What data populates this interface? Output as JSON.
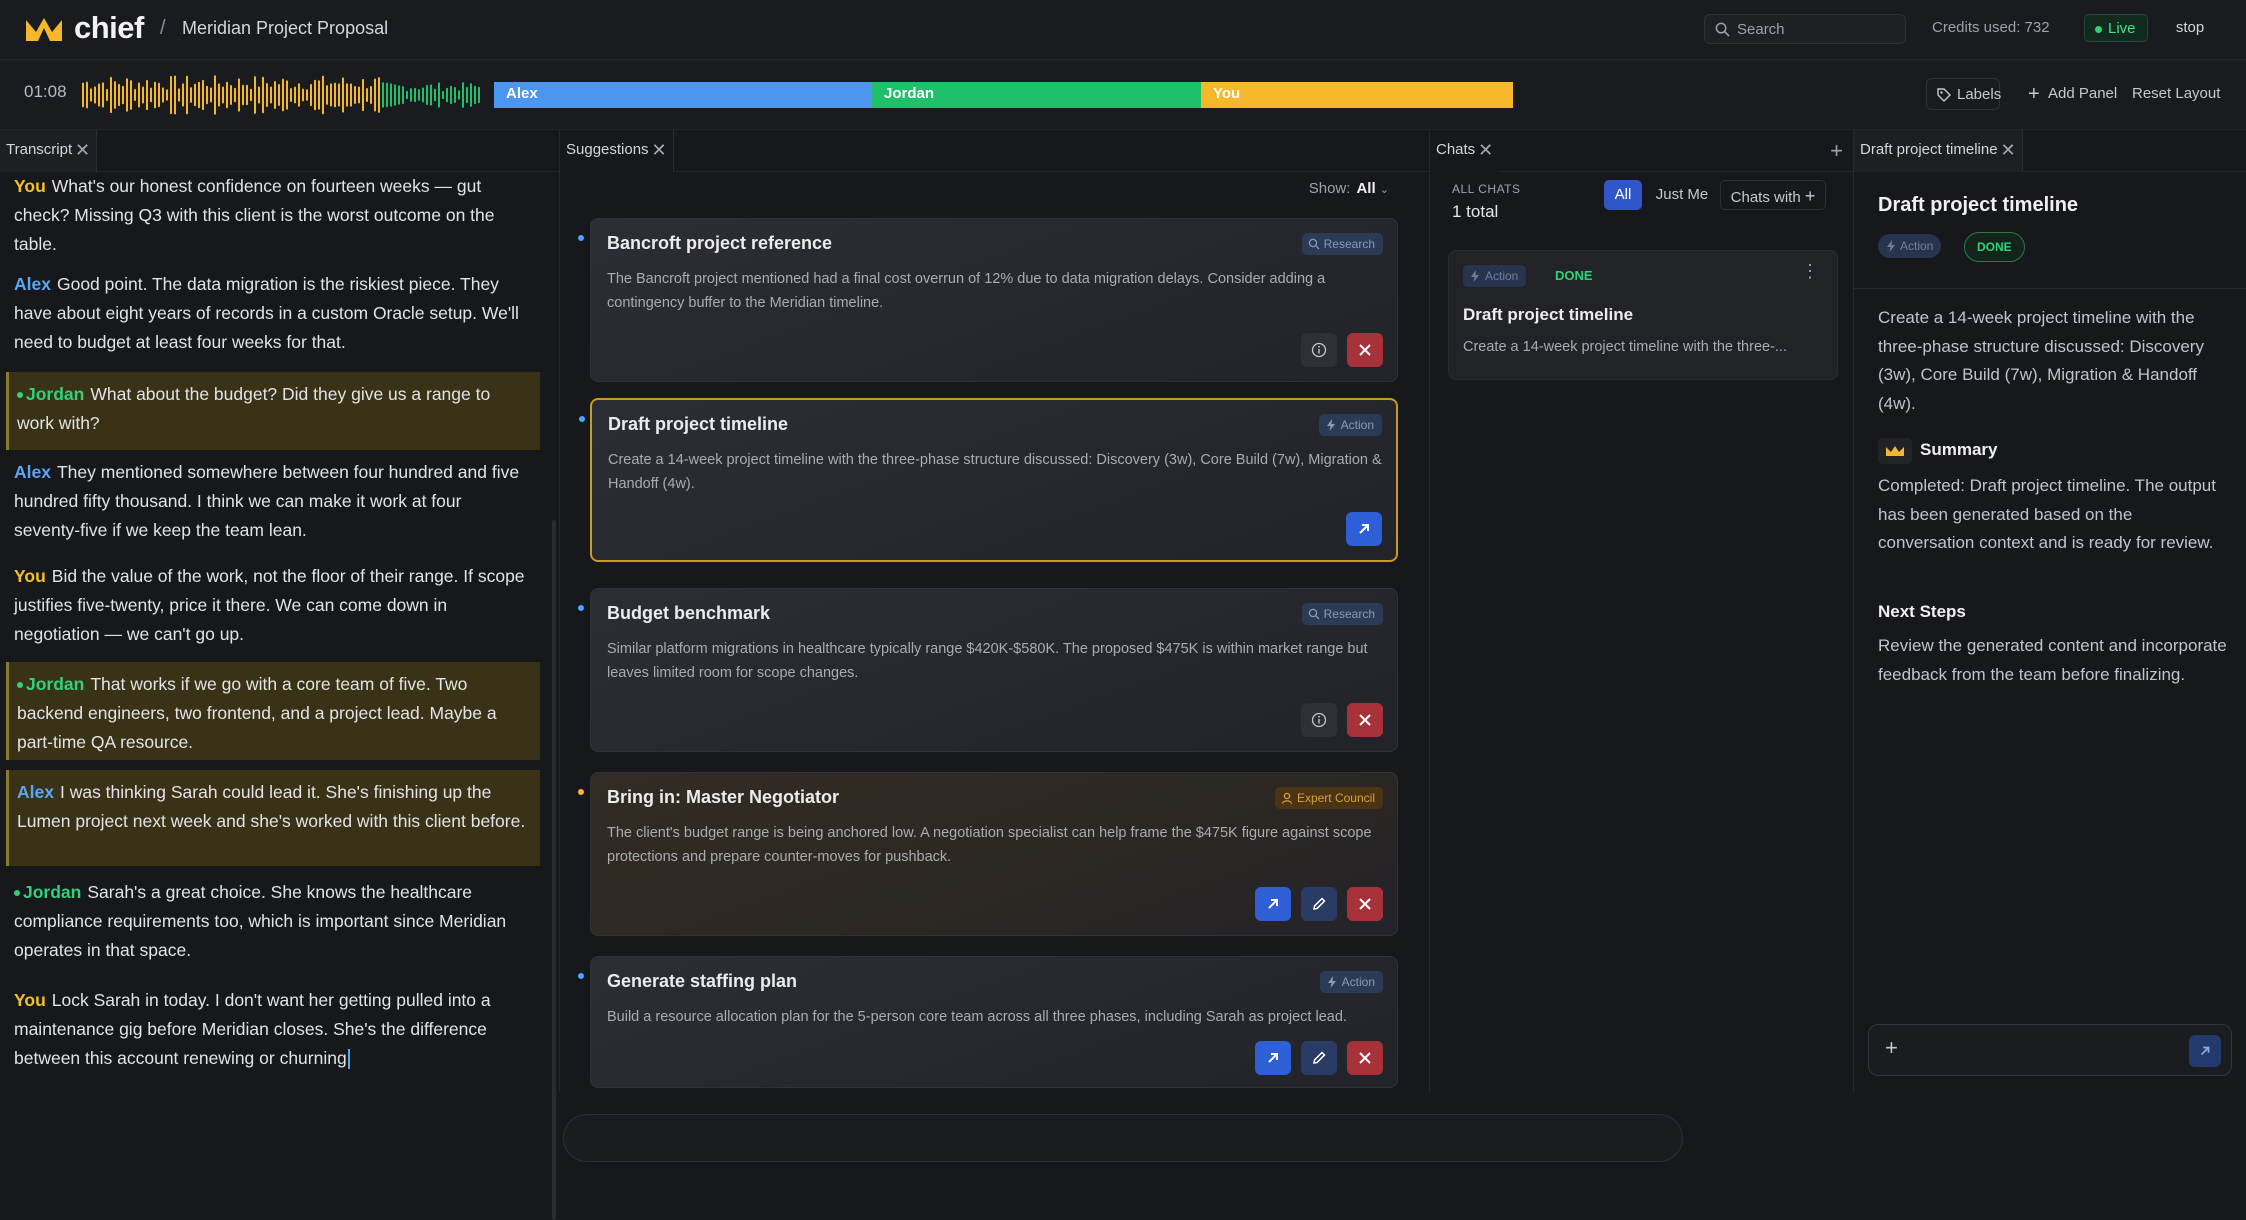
{
  "header": {
    "brand": "chief",
    "separator": "/",
    "project": "Meridian Project Proposal",
    "search_placeholder": "Search",
    "credits": "Credits used:  732",
    "live": "Live",
    "stop": "stop"
  },
  "audio": {
    "time": "01:08",
    "speakers": [
      {
        "name": "Alex",
        "color": "#4a96f0"
      },
      {
        "name": "Jordan",
        "color": "#1fc06a"
      },
      {
        "name": "You",
        "color": "#f5b82a"
      }
    ],
    "labels_btn": "Labels",
    "add_panel": "Add Panel",
    "reset_layout": "Reset Layout"
  },
  "transcript": {
    "tab": "Transcript",
    "messages": [
      {
        "speaker": "You",
        "text": "What's our honest confidence on fourteen weeks — gut check? Missing Q3 with this client is the worst outcome on the table."
      },
      {
        "speaker": "Alex",
        "text": "Good point. The data migration is the riskiest piece. They have about eight years of records in a custom Oracle setup. We'll need to budget at least four weeks for that."
      },
      {
        "speaker": "Jordan",
        "text": "What about the budget? Did they give us a range to work with?"
      },
      {
        "speaker": "Alex",
        "text": "They mentioned somewhere between four hundred and five hundred fifty thousand. I think we can make it work at four seventy-five if we keep the team lean."
      },
      {
        "speaker": "You",
        "text": "Bid the value of the work, not the floor of their range. If scope justifies five-twenty, price it there. We can come down in negotiation — we can't go up."
      },
      {
        "speaker": "Jordan",
        "text": "That works if we go with a core team of five. Two backend engineers, two frontend, and a project lead. Maybe a part-time QA resource."
      },
      {
        "speaker": "Alex",
        "text": "I was thinking Sarah could lead it. She's finishing up the Lumen project next week and she's worked with this client before."
      },
      {
        "speaker": "Jordan",
        "text": "Sarah's a great choice. She knows the healthcare compliance requirements too, which is important since Meridian operates in that space."
      },
      {
        "speaker": "You",
        "text": "Lock Sarah in today. I don't want her getting pulled into a maintenance gig before Meridian closes. She's the difference between this account renewing or churning"
      }
    ]
  },
  "suggestions": {
    "tab": "Suggestions",
    "show_label": "Show:",
    "show_value": "All",
    "cards": [
      {
        "title": "Bancroft project reference",
        "badge": "Research",
        "body": "The Bancroft project mentioned had a final cost overrun of 12% due to data migration delays. Consider adding a contingency buffer to the Meridian timeline."
      },
      {
        "title": "Draft project timeline",
        "badge": "Action",
        "body": "Create a 14-week project timeline with the three-phase structure discussed: Discovery (3w), Core Build (7w), Migration & Handoff (4w)."
      },
      {
        "title": "Budget benchmark",
        "badge": "Research",
        "body": "Similar platform migrations in healthcare typically range $420K-$580K. The proposed $475K is within market range but leaves limited room for scope changes."
      },
      {
        "title": "Bring in: Master Negotiator",
        "badge": "Expert Council",
        "body": "The client's budget range is being anchored low. A negotiation specialist can help frame the $475K figure against scope protections and prepare counter-moves for pushback."
      },
      {
        "title": "Generate staffing plan",
        "badge": "Action",
        "body": "Build a resource allocation plan for the 5-person core team across all three phases, including Sarah as project lead."
      }
    ]
  },
  "chats": {
    "tab": "Chats",
    "all_chats": "ALL CHATS",
    "total": "1 total",
    "filters": {
      "all": "All",
      "me": "Just Me",
      "with": "Chats with"
    },
    "card": {
      "badge": "Action",
      "status": "DONE",
      "title": "Draft project timeline",
      "body": "Create a 14-week project timeline with the three-..."
    }
  },
  "detail": {
    "tab": "Draft project timeline",
    "title": "Draft project timeline",
    "badge": "Action",
    "status": "DONE",
    "description": "Create a 14-week project timeline with the three-phase structure discussed: Discovery (3w), Core Build (7w), Migration & Handoff (4w).",
    "summary_heading": "Summary",
    "summary": "Completed: Draft project timeline. The output has been generated based on the conversation context and is ready for review.",
    "next_heading": "Next Steps",
    "next": "Review the generated content and incorporate feedback from the team before finalizing."
  }
}
